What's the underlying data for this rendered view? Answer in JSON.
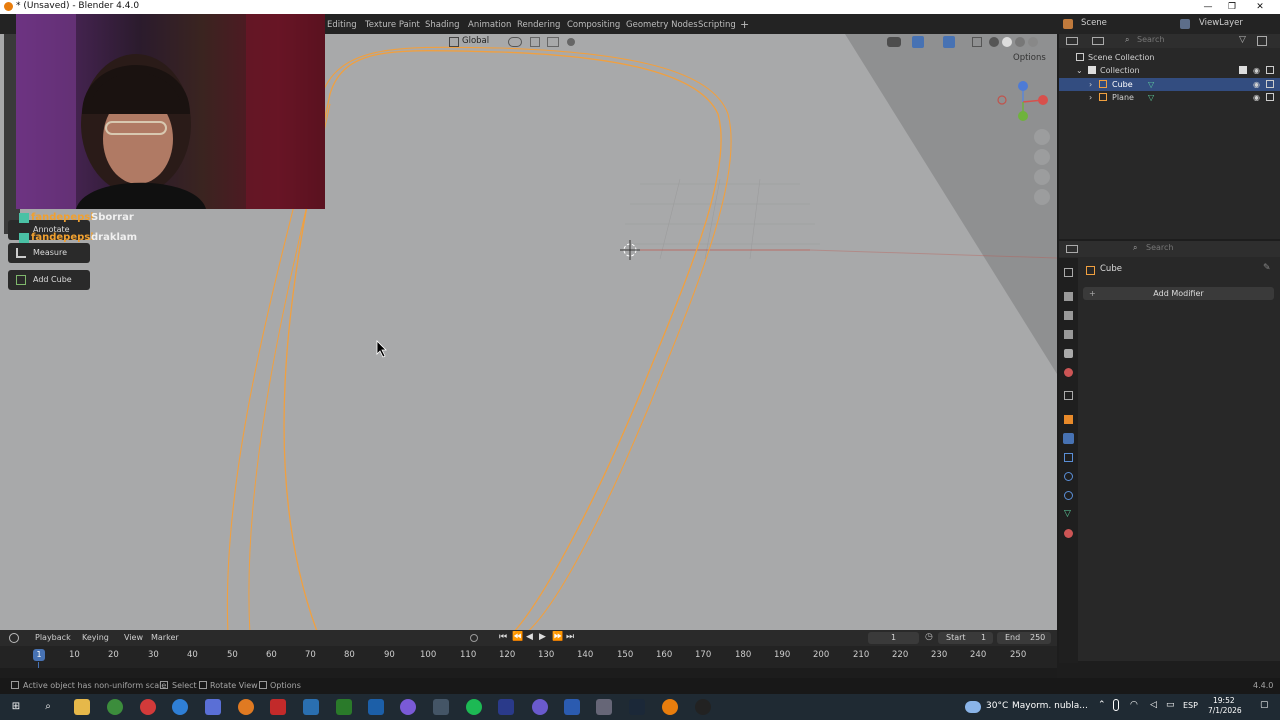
{
  "window": {
    "title": "* (Unsaved) - Blender 4.4.0",
    "minimize": "—",
    "maximize": "❐",
    "close": "✕"
  },
  "workspaces": [
    "Editing",
    "Texture Paint",
    "Shading",
    "Animation",
    "Rendering",
    "Compositing",
    "Geometry Nodes",
    "Scripting",
    "+"
  ],
  "topbar": {
    "scene_label": "Scene",
    "viewlayer_label": "ViewLayer"
  },
  "viewport": {
    "transform_orientation": "Global",
    "options_label": "Options"
  },
  "tools": {
    "annotate": "Annotate",
    "measure": "Measure",
    "add_cube": "Add Cube"
  },
  "chat": [
    {
      "user": "fandepepsi",
      "message": "Sborrar"
    },
    {
      "user": "fandepepsi",
      "message": "draklam"
    }
  ],
  "outliner": {
    "search_placeholder": "Search",
    "scene_collection": "Scene Collection",
    "collection": "Collection",
    "items": [
      "Cube",
      "Plane"
    ]
  },
  "properties": {
    "search_placeholder": "Search",
    "object_name": "Cube",
    "add_modifier": "Add Modifier"
  },
  "timeline": {
    "menus": [
      "Playback",
      "Keying",
      "View",
      "Marker"
    ],
    "current_frame": "1",
    "start_label": "Start",
    "start_value": "1",
    "end_label": "End",
    "end_value": "250",
    "ticks": [
      "1",
      "10",
      "20",
      "30",
      "40",
      "50",
      "60",
      "70",
      "80",
      "90",
      "100",
      "110",
      "120",
      "130",
      "140",
      "150",
      "160",
      "170",
      "180",
      "190",
      "200",
      "210",
      "220",
      "230",
      "240",
      "250"
    ]
  },
  "statusbar": {
    "message": "Active object has non-uniform scale",
    "select": "Select",
    "rotate_view": "Rotate View",
    "options": "Options",
    "version": "4.4.0"
  },
  "taskbar": {
    "weather": "30°C",
    "weather_text": "Mayorm. nubla...",
    "language": "ESP",
    "time": "19:52",
    "date": "7/1/2026"
  },
  "colors": {
    "viewport_bg": "#a8a9aa",
    "selection_orange": "#f0a040",
    "accent_blue": "#4772b3",
    "panel_bg": "#282828"
  }
}
